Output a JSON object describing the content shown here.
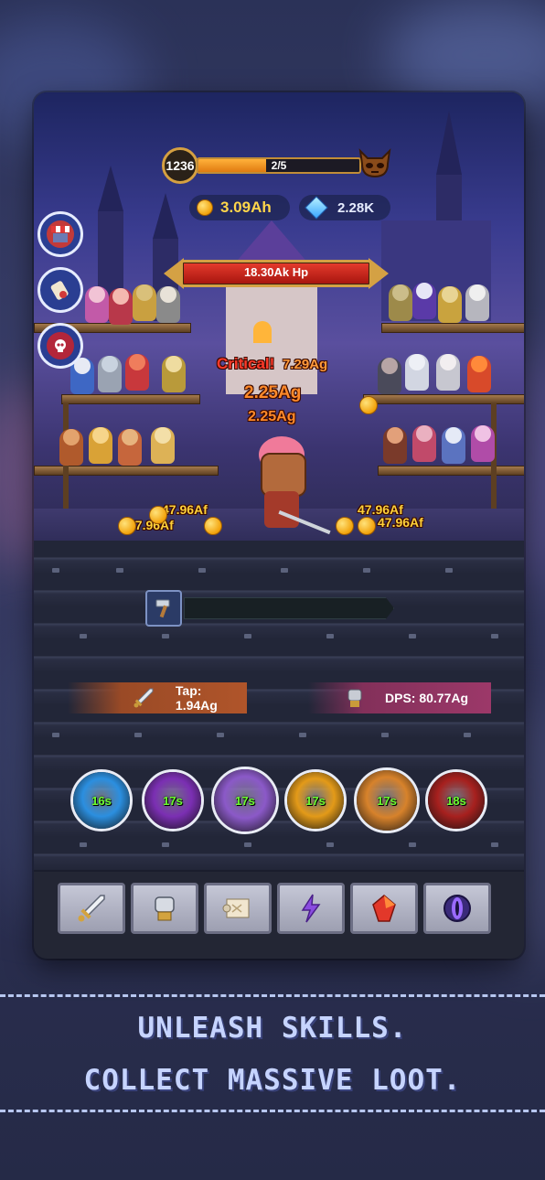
{
  "hud": {
    "stage_level": "1236",
    "wave_progress": "2/5",
    "wave_fraction": 0.42,
    "gold": "3.09Ah",
    "gems": "2.28K"
  },
  "boss": {
    "hp_label": "18.30Ak Hp",
    "hp_fraction": 1.0
  },
  "side_buttons": [
    {
      "name": "shop",
      "icon": "shop-awning-icon"
    },
    {
      "name": "quests",
      "icon": "scroll-icon"
    },
    {
      "name": "boss",
      "icon": "skull-emblem-icon"
    }
  ],
  "combat_text": {
    "critical_label": "Critical!",
    "critical_value": "7.29Ag",
    "hit1": "2.25Ag",
    "hit2": "2.25Ag",
    "gold_left_1": "47.96Af",
    "gold_left_2": "47.96Af",
    "gold_right_1": "47.96Af",
    "gold_right_2": "47.96Af"
  },
  "stats": {
    "tap": "Tap: 1.94Ag",
    "dps": "DPS: 80.77Ag"
  },
  "skills": [
    {
      "name": "frost-hand",
      "cooldown": "16s",
      "color": "#2b8fe0"
    },
    {
      "name": "dark-axe",
      "cooldown": "17s",
      "color": "#7b2fb3"
    },
    {
      "name": "purple-vortex",
      "cooldown": "17s",
      "color": "#8b59c8"
    },
    {
      "name": "golden-slash",
      "cooldown": "17s",
      "color": "#e39a18"
    },
    {
      "name": "lotus-flame",
      "cooldown": "17s",
      "color": "#d7822b"
    },
    {
      "name": "crimson-blade",
      "cooldown": "18s",
      "color": "#a7201e"
    }
  ],
  "menu": [
    {
      "name": "heroes",
      "icon": "sword-icon"
    },
    {
      "name": "upgrades",
      "icon": "gauntlet-icon"
    },
    {
      "name": "map",
      "icon": "map-scroll-icon"
    },
    {
      "name": "skills",
      "icon": "lightning-icon"
    },
    {
      "name": "relics",
      "icon": "red-gem-icon"
    },
    {
      "name": "portal",
      "icon": "eye-orb-icon"
    }
  ],
  "caption": {
    "line1": "UNLEASH SKILLS.",
    "line2": "COLLECT MASSIVE LOOT."
  }
}
